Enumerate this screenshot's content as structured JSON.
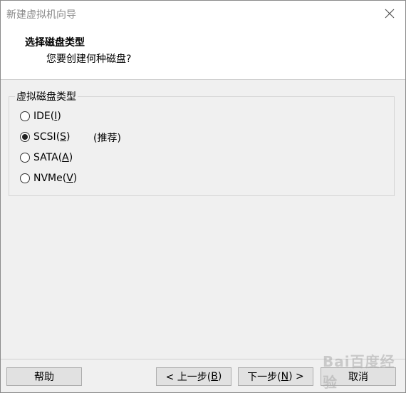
{
  "window": {
    "title": "新建虚拟机向导"
  },
  "header": {
    "title": "选择磁盘类型",
    "subtitle": "您要创建何种磁盘?"
  },
  "group": {
    "label": "虚拟磁盘类型",
    "options": [
      {
        "name": "IDE",
        "mnemonic": "I",
        "selected": false,
        "note": ""
      },
      {
        "name": "SCSI",
        "mnemonic": "S",
        "selected": true,
        "note": "(推荐)"
      },
      {
        "name": "SATA",
        "mnemonic": "A",
        "selected": false,
        "note": ""
      },
      {
        "name": "NVMe",
        "mnemonic": "V",
        "selected": false,
        "note": ""
      }
    ]
  },
  "buttons": {
    "help": "帮助",
    "back": {
      "prefix": "< 上一步(",
      "mnemonic": "B",
      "suffix": ")"
    },
    "next": {
      "prefix": "下一步(",
      "mnemonic": "N",
      "suffix": ") >"
    },
    "cancel": "取消"
  },
  "watermark": "Bai百度经验"
}
